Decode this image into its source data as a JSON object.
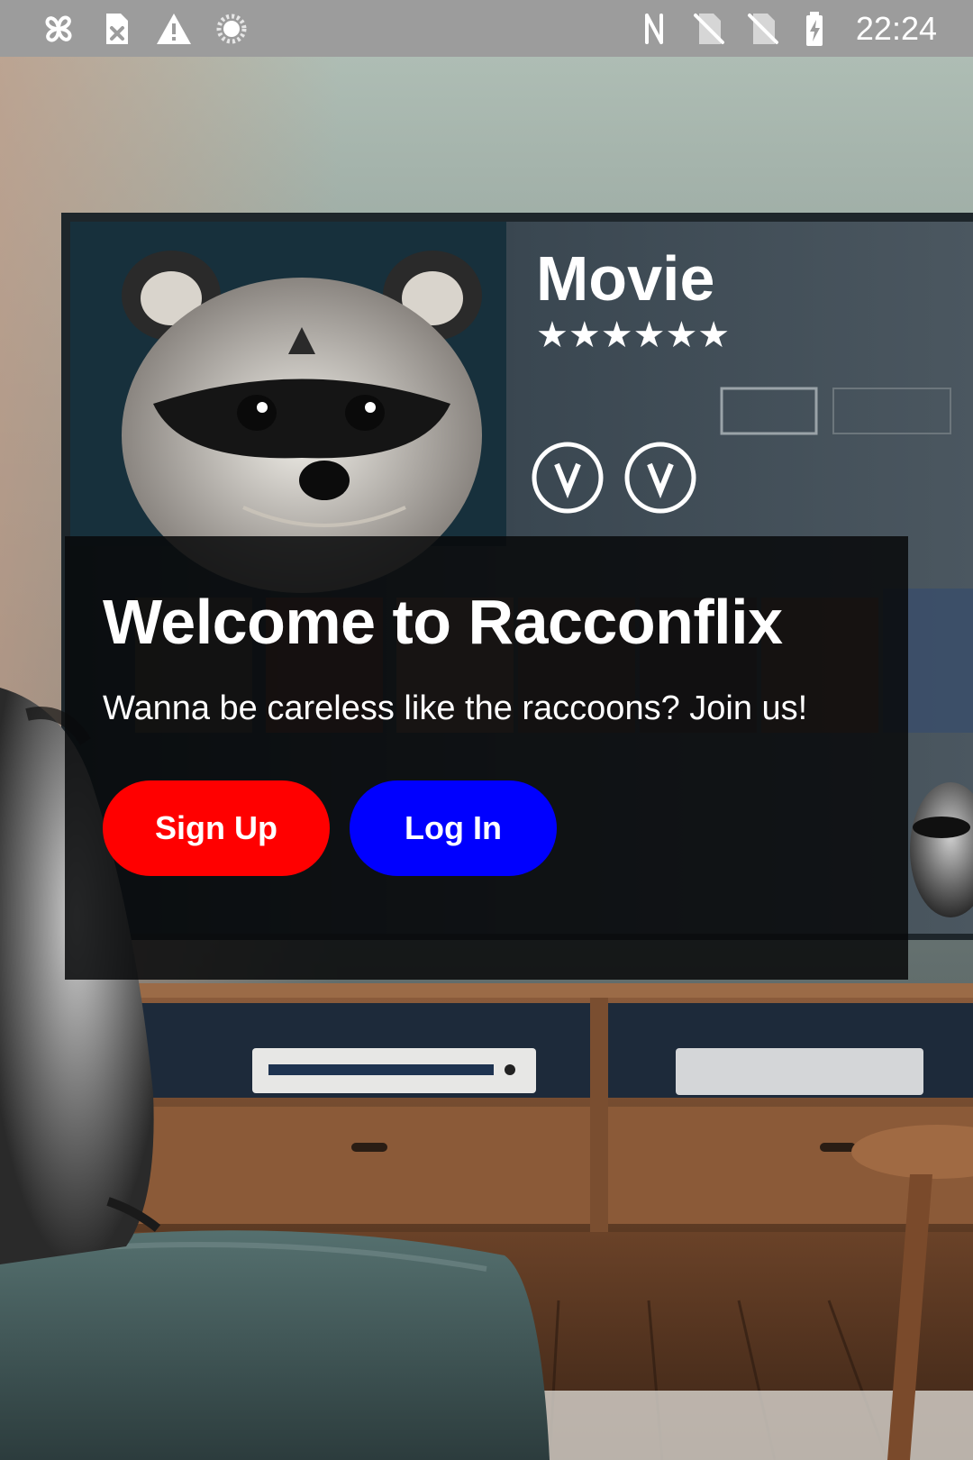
{
  "status_bar": {
    "time": "22:24",
    "left_icons": [
      "pinwheel-icon",
      "sim-error-icon",
      "warning-icon",
      "loading-circle-icon"
    ],
    "right_icons": [
      "nfc-icon",
      "no-sim-icon",
      "no-sim-icon",
      "battery-charging-icon"
    ]
  },
  "background": {
    "tv_screen_title": "Movie",
    "description": "Raccoon in living room watching movie streaming app on TV"
  },
  "welcome": {
    "title": "Welcome to Racconflix",
    "subtitle": "Wanna be careless like the raccoons? Join us!",
    "signup_label": "Sign Up",
    "login_label": "Log In"
  },
  "colors": {
    "signup_button": "#ff0000",
    "login_button": "#0000ff",
    "status_bar": "#9c9c9c",
    "card_overlay": "rgba(8,9,10,0.86)"
  }
}
